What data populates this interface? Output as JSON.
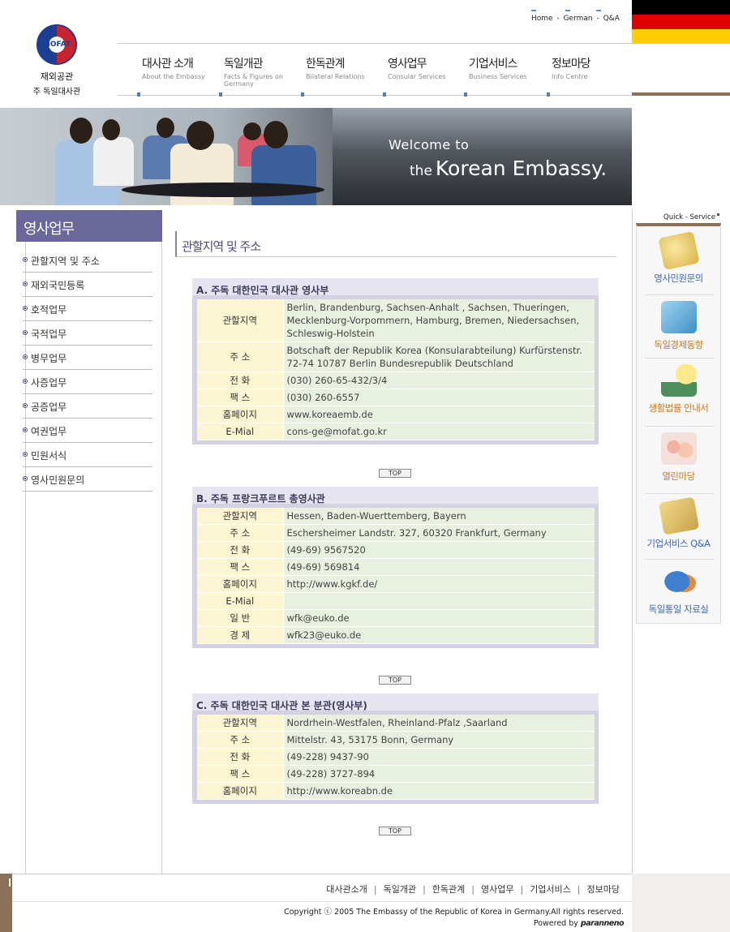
{
  "logo": {
    "seal_text": "MOFAT",
    "line1": "재외공관",
    "line2": "주 독일대사관"
  },
  "topnav": [
    "Home",
    "German",
    "Q&A"
  ],
  "flag_colors": [
    "#000000",
    "#dd0000",
    "#ffce00"
  ],
  "menu": [
    {
      "ko": "대사관 소개",
      "en": "About the Embassy"
    },
    {
      "ko": "독일개관",
      "en": "Facts & Figures on Germany"
    },
    {
      "ko": "한독관계",
      "en": "Bilateral Relations"
    },
    {
      "ko": "영사업무",
      "en": "Consular Services"
    },
    {
      "ko": "기업서비스",
      "en": "Business Services"
    },
    {
      "ko": "정보마당",
      "en": "Info Centre"
    }
  ],
  "banner": {
    "line1": "Welcome to",
    "the": "the",
    "line2": "Korean Embassy."
  },
  "sidebar": {
    "title": "영사업무",
    "items": [
      "관할지역 및 주소",
      "재외국민등록",
      "호적업무",
      "국적업무",
      "병무업무",
      "사증업무",
      "공증업무",
      "여권업무",
      "민원서식",
      "영사민원문의"
    ]
  },
  "page_title": "관할지역 및 주소",
  "offices": [
    {
      "heading": "A. 주독 대한민국 대사관 영사부",
      "rows": [
        {
          "k": "관할지역",
          "v": "Berlin, Brandenburg, Sachsen-Anhalt , Sachsen, Thueringen, Mecklenburg-Vorpommern, Hamburg, Bremen, Niedersachsen, Schleswig-Holstein"
        },
        {
          "k": "주 소",
          "v": "Botschaft der Republik Korea (Konsularabteilung) Kurfürstenstr. 72-74 10787 Berlin Bundesrepublik Deutschland"
        },
        {
          "k": "전 화",
          "v": "(030) 260-65-432/3/4"
        },
        {
          "k": "팩 스",
          "v": "(030) 260-6557"
        },
        {
          "k": "홈페이지",
          "v": "www.koreaemb.de"
        },
        {
          "k": "E-Mial",
          "v": "cons-ge@mofat.go.kr"
        }
      ]
    },
    {
      "heading": "B. 주독 프랑크푸르트 총영사관",
      "rows": [
        {
          "k": "관할지역",
          "v": "Hessen, Baden-Wuerttemberg, Bayern"
        },
        {
          "k": "주 소",
          "v": "Eschersheimer Landstr. 327, 60320 Frankfurt, Germany"
        },
        {
          "k": "전 화",
          "v": "(49-69) 9567520"
        },
        {
          "k": "팩 스",
          "v": "(49-69) 569814"
        },
        {
          "k": "홈페이지",
          "v": "http://www.kgkf.de/"
        },
        {
          "k": "E-Mial",
          "v": ""
        },
        {
          "k": "일 반",
          "v": "wfk@euko.de"
        },
        {
          "k": "경 제",
          "v": "wfk23@euko.de"
        }
      ]
    },
    {
      "heading": "C. 주독 대한민국 대사관 본 분관(영사부)",
      "rows": [
        {
          "k": "관할지역",
          "v": "Nordrhein-Westfalen, Rheinland-Pfalz ,Saarland"
        },
        {
          "k": "주 소",
          "v": "Mittelstr. 43, 53175 Bonn, Germany"
        },
        {
          "k": "전 화",
          "v": "(49-228) 9437-90"
        },
        {
          "k": "팩 스",
          "v": "(49-228) 3727-894"
        },
        {
          "k": "홈페이지",
          "v": "http://www.koreabn.de"
        }
      ]
    }
  ],
  "top_button": "TOP",
  "quick_service": {
    "label": "Quick - Service",
    "items": [
      {
        "label": "영사민원문의",
        "icon": "notepad-icon",
        "color": "blue"
      },
      {
        "label": "독일경제동향",
        "icon": "chart-icon",
        "color": "orange"
      },
      {
        "label": "생활법률 안내서",
        "icon": "lightbulb-book-icon",
        "color": "orange"
      },
      {
        "label": "열린마당",
        "icon": "people-icon",
        "color": "orange"
      },
      {
        "label": "기업서비스 Q&A",
        "icon": "qa-icon",
        "color": "blue"
      },
      {
        "label": "독일통일 자료실",
        "icon": "map-icon",
        "color": "blue"
      }
    ]
  },
  "footer": {
    "links": [
      "대사관소개",
      "독일개관",
      "한독관계",
      "영사업무",
      "기업서비스",
      "정보마당"
    ],
    "copyright": "Copyright ⓒ 2005 The Embassy of the Republic of Korea in Germany.All rights reserved.",
    "powered": "Powered by",
    "powered_brand": "paranneno"
  }
}
